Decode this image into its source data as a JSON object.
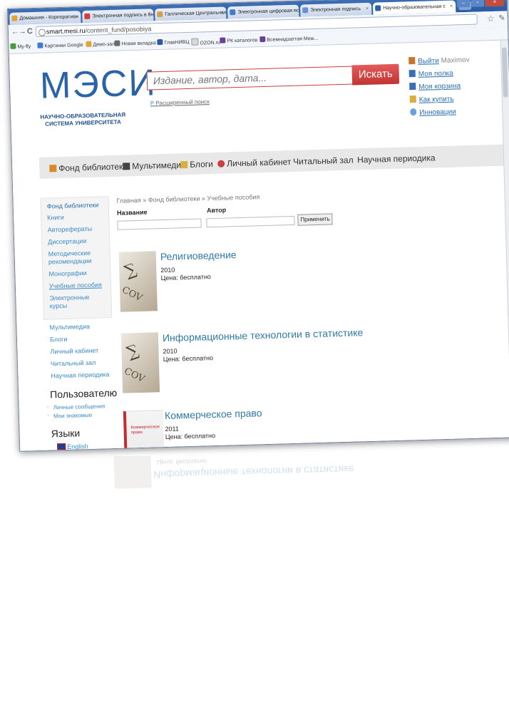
{
  "browser": {
    "tabs": [
      {
        "label": "Домашняя - Корпоративн",
        "color": "#e0a53a"
      },
      {
        "label": "Электронная подпись в бно",
        "color": "#d04038"
      },
      {
        "label": "Галлическая Центральная",
        "color": "#d4a04a"
      },
      {
        "label": "Электронная цифровая по",
        "color": "#3f7bd0"
      },
      {
        "label": "Электронная подпись",
        "color": "#6b8fd4"
      },
      {
        "label": "Научно-образовательная с",
        "color": "#2a63a8"
      }
    ],
    "tab_close": "×",
    "newtab": "+",
    "window_controls": [
      "–",
      "▫",
      "×"
    ],
    "address": {
      "host": "smart.mesi.ru",
      "path": "/content_fund/posobiya"
    },
    "nav": {
      "back": "←",
      "forward": "→",
      "reload": "C"
    },
    "bookmarks": [
      {
        "label": "My-fly",
        "color": "#4a9b3b"
      },
      {
        "label": "Картинки Google",
        "color": "#3f7bd0"
      },
      {
        "label": "Демо-зал",
        "color": "#e0a53a"
      },
      {
        "label": "Новая вкладка",
        "color": "#6b6b6b"
      },
      {
        "label": "ГлавНИВЦ",
        "color": "#2a5aa3"
      },
      {
        "label": "OZON.ru",
        "color": "#d8d8d8"
      },
      {
        "label": "РК каталогов",
        "color": "#6a3f9a"
      },
      {
        "label": "Всемнадзаттая Меж...",
        "color": "#6a3f9a"
      }
    ]
  },
  "header": {
    "logo": "МЭСИ",
    "logo_sub": "НАУЧНО-ОБРАЗОВАТЕЛЬНАЯ СИСТЕМА УНИВЕРСИТЕТА",
    "search_placeholder": "Издание, автор, дата...",
    "search_button": "Искать",
    "advanced_prefix": "Р",
    "advanced_search": "Расширенный поиск"
  },
  "user_links": {
    "login": "Выйти",
    "username": "Maximov",
    "shelf": "Моя полка",
    "cart": "Моя корзина",
    "how_to_buy": "Как купить",
    "innovations": "Инновации"
  },
  "mainnav": [
    {
      "label": "Фонд библиотеки",
      "icon": "book-icon",
      "color": "#d88a2a"
    },
    {
      "label": "Мультимедиа",
      "icon": "film-icon",
      "color": "#444"
    },
    {
      "label": "Блоги",
      "icon": "blog-icon",
      "color": "#d8b040"
    },
    {
      "label": "Личный кабинет",
      "icon": "cabinet-icon",
      "color": "#c84040"
    },
    {
      "label": "Читальный зал",
      "icon": "",
      "color": ""
    },
    {
      "label": "Научная периодика",
      "icon": "",
      "color": ""
    }
  ],
  "sidebar": {
    "head": "Фонд библиотеки",
    "items": [
      "Книги",
      "Авторефераты",
      "Диссертации",
      "Методические рекомендации",
      "Монографии",
      "Учебные пособия",
      "Электронные курсы"
    ],
    "plain": [
      "Мультимедиа",
      "Блоги",
      "Личный кабинет",
      "Читальный зал",
      "Научная периодика"
    ],
    "user_heading": "Пользователю",
    "user_items": [
      "Личные сообщения",
      "Мои знакомые"
    ],
    "lang_heading": "Языки",
    "lang_item": "English"
  },
  "content": {
    "breadcrumb": "Главная » Фонд библиотеки » Учебные пособия",
    "filter_name": "Название",
    "filter_author": "Автор",
    "apply": "Применить",
    "items": [
      {
        "title": "Религиоведение",
        "year": "2010",
        "price": "Цена: бесплатно"
      },
      {
        "title": "Информационные технологии в статистике",
        "year": "2010",
        "price": "Цена: бесплатно"
      },
      {
        "title": "Коммерческое право",
        "year": "2011",
        "price": "Цена: бесплатно"
      }
    ]
  },
  "colors": {
    "accent": "#2a63a8",
    "search": "#c83e3e",
    "link": "#2e7aa8"
  }
}
